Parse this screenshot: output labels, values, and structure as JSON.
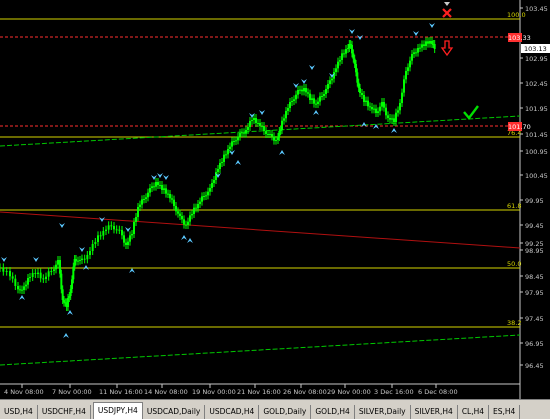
{
  "chart": {
    "symbol": "USDJPY",
    "timeframe": "H4",
    "price_scale": [
      "103.45",
      "103.13",
      "102.95",
      "102.45",
      "101.95",
      "101.45",
      "100.95",
      "100.45",
      "99.95",
      "99.45",
      "99.25",
      "98.95",
      "98.45",
      "97.95",
      "97.45",
      "96.95",
      "96.45"
    ],
    "time_scale": [
      "4 Nov 08:00",
      "7 Nov 00:00",
      "11 Nov 16:00",
      "14 Nov 08:00",
      "19 Nov 00:00",
      "21 Nov 16:00",
      "26 Nov 08:00",
      "29 Nov 00:00",
      "3 Dec 16:00",
      "6 Dec 08:00"
    ],
    "fib_levels": [
      "100.0",
      "76.4",
      "61.8",
      "50.0",
      "38.2"
    ],
    "current_price": "103.13",
    "red_tag_upper": "103.33",
    "red_tag_lower": "101.70",
    "colors": {
      "background": "#000000",
      "candle": "#00ff00",
      "fib_line": "#d4d400",
      "red_line": "#ff3030",
      "trend_green": "#00c800",
      "trend_red": "#b01010",
      "arrow": "#5bc8ff"
    },
    "signal_icons": [
      "red-x-icon",
      "red-down-arrow-icon",
      "green-check-icon"
    ]
  },
  "tabs": [
    {
      "label": "USD,H4"
    },
    {
      "label": "USDCHF,H4"
    },
    {
      "label": "USDJPY,H4",
      "active": true
    },
    {
      "label": "USDCAD,Daily"
    },
    {
      "label": "USDCAD,H4"
    },
    {
      "label": "GOLD,Daily"
    },
    {
      "label": "GOLD,H4"
    },
    {
      "label": "SILVER,Daily"
    },
    {
      "label": "SILVER,H4"
    },
    {
      "label": "CL,H4"
    },
    {
      "label": "ES,H4"
    }
  ]
}
